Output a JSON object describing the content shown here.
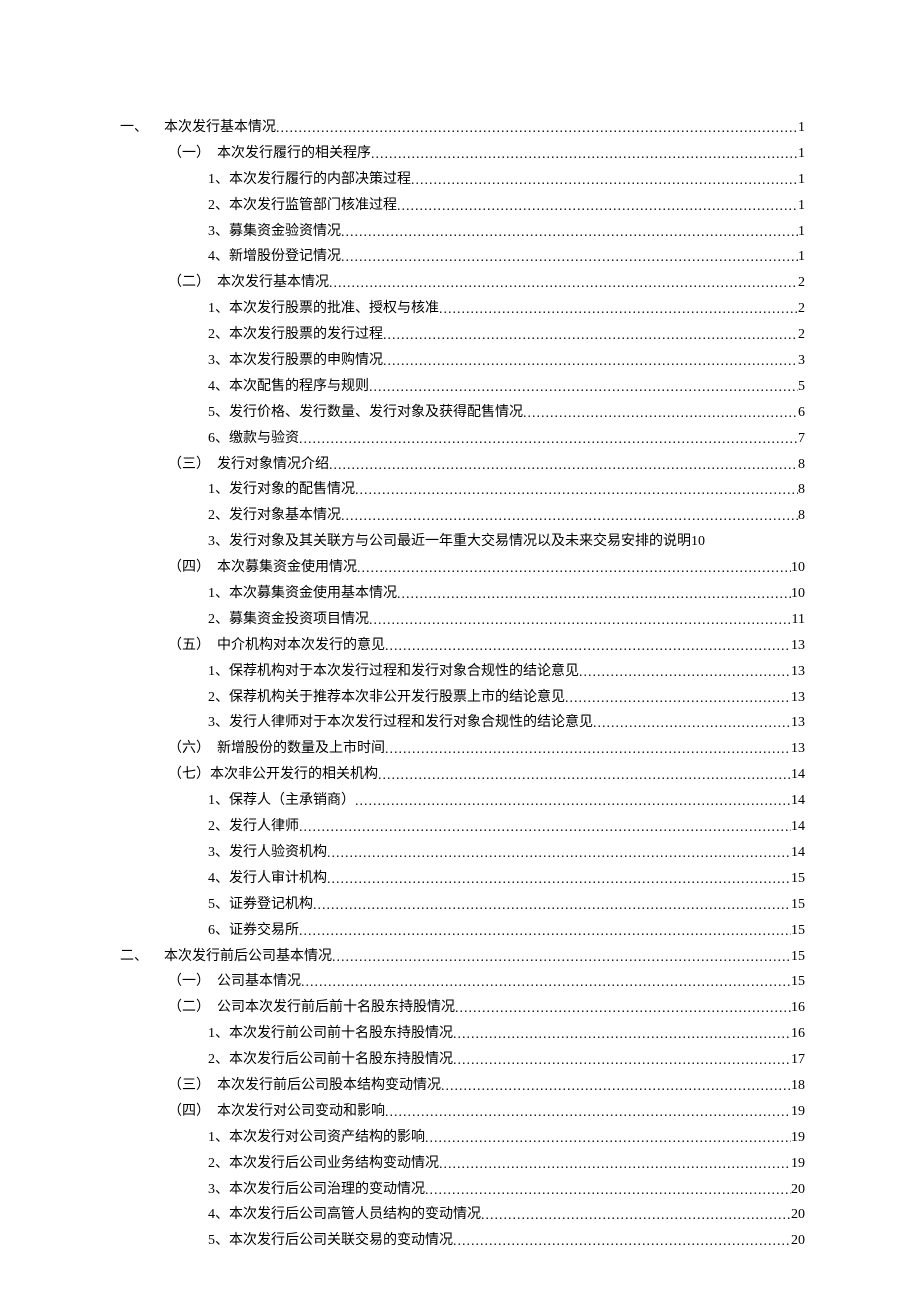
{
  "toc": [
    {
      "level": 0,
      "prefix": "一、",
      "title": "本次发行基本情况",
      "page": "1"
    },
    {
      "level": 1,
      "prefix": "（一）",
      "title": "本次发行履行的相关程序",
      "page": "1"
    },
    {
      "level": 2,
      "prefix": "1、",
      "title": "本次发行履行的内部决策过程",
      "page": "1"
    },
    {
      "level": 2,
      "prefix": "2、",
      "title": "本次发行监管部门核准过程",
      "page": "1"
    },
    {
      "level": 2,
      "prefix": "3、",
      "title": "募集资金验资情况",
      "page": "1"
    },
    {
      "level": 2,
      "prefix": "4、",
      "title": "新增股份登记情况",
      "page": "1"
    },
    {
      "level": 1,
      "prefix": "（二）",
      "title": "本次发行基本情况",
      "page": "2"
    },
    {
      "level": 2,
      "prefix": "1、",
      "title": "本次发行股票的批准、授权与核准",
      "page": "2"
    },
    {
      "level": 2,
      "prefix": "2、",
      "title": "本次发行股票的发行过程",
      "page": "2"
    },
    {
      "level": 2,
      "prefix": "3、",
      "title": "本次发行股票的申购情况",
      "page": "3"
    },
    {
      "level": 2,
      "prefix": "4、",
      "title": "本次配售的程序与规则",
      "page": "5"
    },
    {
      "level": 2,
      "prefix": "5、",
      "title": "发行价格、发行数量、发行对象及获得配售情况",
      "page": "6"
    },
    {
      "level": 2,
      "prefix": "6、",
      "title": "缴款与验资",
      "page": "7"
    },
    {
      "level": 1,
      "prefix": "（三）",
      "title": "发行对象情况介绍",
      "page": "8"
    },
    {
      "level": 2,
      "prefix": "1、",
      "title": "发行对象的配售情况",
      "page": "8"
    },
    {
      "level": 2,
      "prefix": "2、",
      "title": "发行对象基本情况",
      "page": "8"
    },
    {
      "level": 2,
      "prefix": "3、",
      "title": "发行对象及其关联方与公司最近一年重大交易情况以及未来交易安排的说明",
      "page": "10",
      "nodots": true
    },
    {
      "level": 1,
      "prefix": "（四）",
      "title": "本次募集资金使用情况",
      "page": "10"
    },
    {
      "level": 2,
      "prefix": "1、",
      "title": "本次募集资金使用基本情况",
      "page": "10"
    },
    {
      "level": 2,
      "prefix": "2、",
      "title": "募集资金投资项目情况",
      "page": "11"
    },
    {
      "level": 1,
      "prefix": "（五）",
      "title": "中介机构对本次发行的意见",
      "page": "13"
    },
    {
      "level": 2,
      "prefix": "1、",
      "title": "保荐机构对于本次发行过程和发行对象合规性的结论意见",
      "page": "13"
    },
    {
      "level": 2,
      "prefix": "2、",
      "title": "保荐机构关于推荐本次非公开发行股票上市的结论意见",
      "page": "13"
    },
    {
      "level": 2,
      "prefix": "3、",
      "title": "发行人律师对于本次发行过程和发行对象合规性的结论意见",
      "page": "13"
    },
    {
      "level": 1,
      "prefix": "（六）",
      "title": "新增股份的数量及上市时间",
      "page": "13"
    },
    {
      "level": 1,
      "prefix": "（七）",
      "title": "本次非公开发行的相关机构",
      "page": "14",
      "tight": true
    },
    {
      "level": 2,
      "prefix": "1、",
      "title": "保荐人（主承销商）",
      "page": "14"
    },
    {
      "level": 2,
      "prefix": "2、",
      "title": "发行人律师",
      "page": "14"
    },
    {
      "level": 2,
      "prefix": "3、",
      "title": "发行人验资机构",
      "page": "14"
    },
    {
      "level": 2,
      "prefix": "4、",
      "title": "发行人审计机构",
      "page": "15"
    },
    {
      "level": 2,
      "prefix": "5、",
      "title": "证券登记机构",
      "page": "15"
    },
    {
      "level": 2,
      "prefix": "6、",
      "title": "证券交易所",
      "page": "15"
    },
    {
      "level": 0,
      "prefix": "二、",
      "title": "本次发行前后公司基本情况",
      "page": "15"
    },
    {
      "level": 1,
      "prefix": "（一）",
      "title": "公司基本情况",
      "page": "15"
    },
    {
      "level": 1,
      "prefix": "（二）",
      "title": "公司本次发行前后前十名股东持股情况",
      "page": "16"
    },
    {
      "level": 2,
      "prefix": "1、",
      "title": "本次发行前公司前十名股东持股情况",
      "page": "16"
    },
    {
      "level": 2,
      "prefix": "2、",
      "title": "本次发行后公司前十名股东持股情况",
      "page": "17"
    },
    {
      "level": 1,
      "prefix": "（三）",
      "title": "本次发行前后公司股本结构变动情况",
      "page": "18"
    },
    {
      "level": 1,
      "prefix": "（四）",
      "title": "本次发行对公司变动和影响",
      "page": "19"
    },
    {
      "level": 2,
      "prefix": "1、",
      "title": "本次发行对公司资产结构的影响",
      "page": "19"
    },
    {
      "level": 2,
      "prefix": "2、",
      "title": "本次发行后公司业务结构变动情况",
      "page": "19"
    },
    {
      "level": 2,
      "prefix": "3、",
      "title": "本次发行后公司治理的变动情况",
      "page": "20"
    },
    {
      "level": 2,
      "prefix": "4、",
      "title": "本次发行后公司高管人员结构的变动情况",
      "page": "20"
    },
    {
      "level": 2,
      "prefix": "5、",
      "title": "本次发行后公司关联交易的变动情况",
      "page": "20"
    }
  ]
}
